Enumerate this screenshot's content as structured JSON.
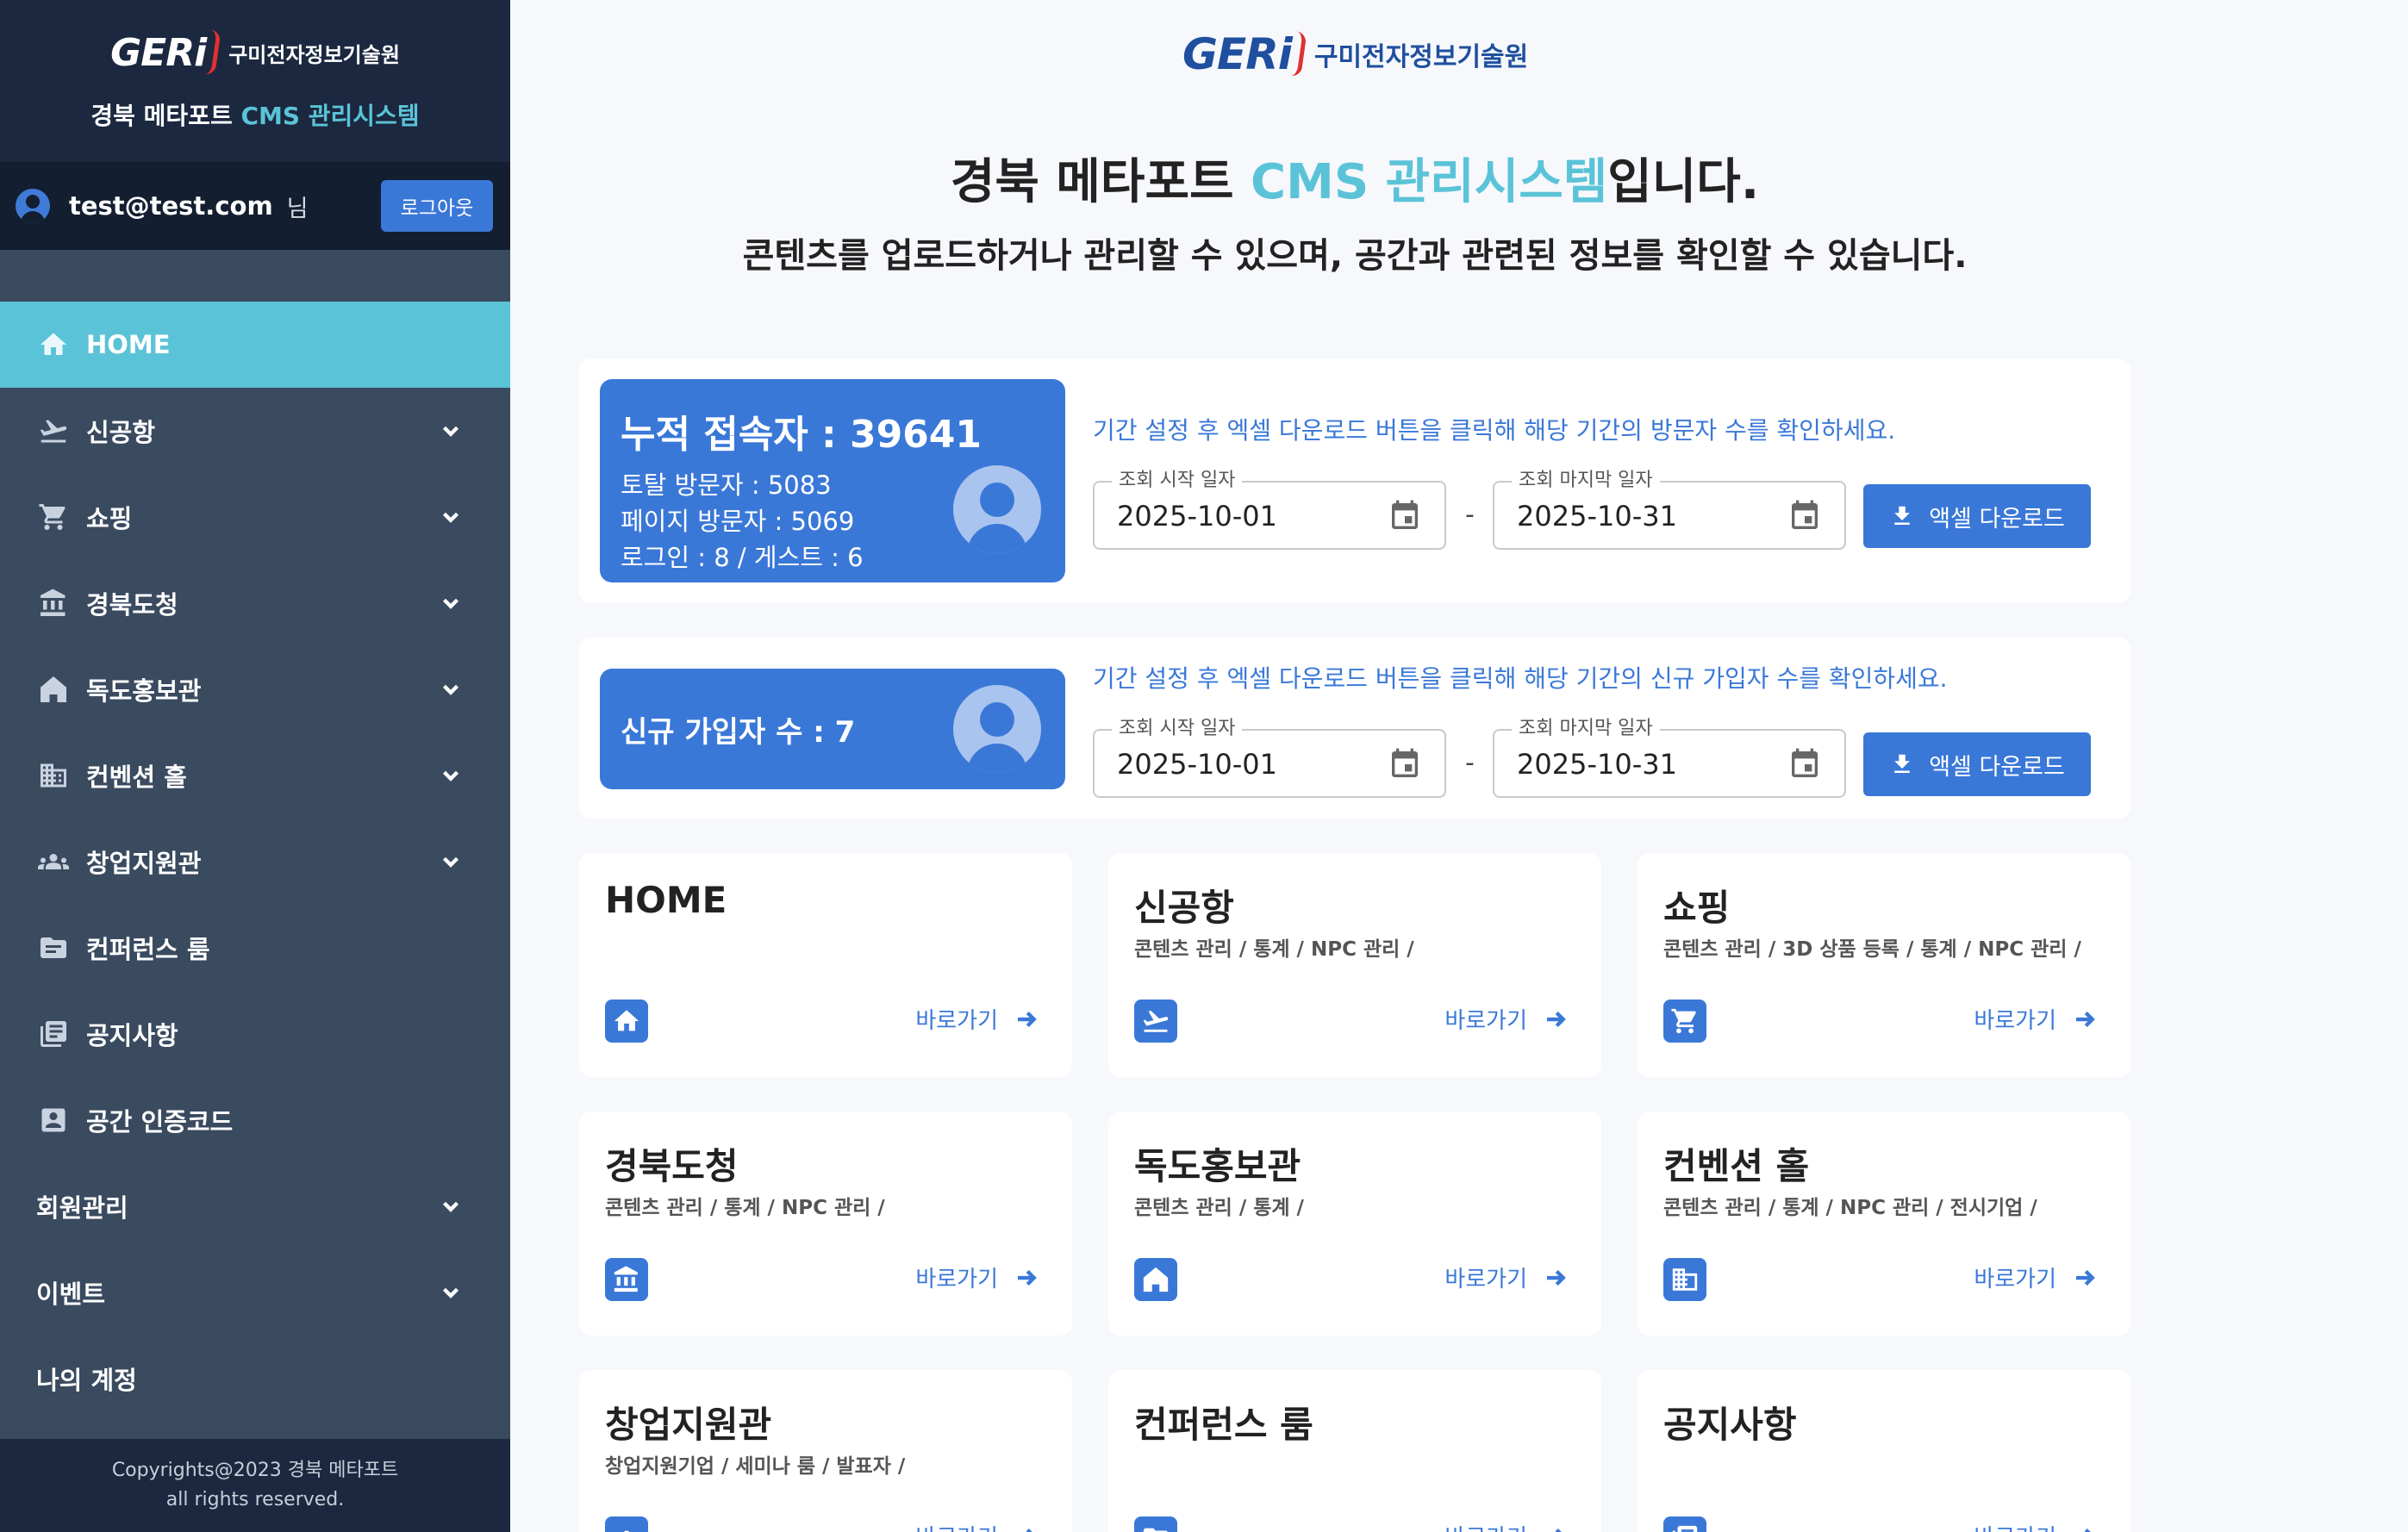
{
  "brand": {
    "logo_text": "GERi",
    "org_name": "구미전자정보기술원",
    "system_title_prefix": "경북 메타포트 ",
    "system_title_accent": "CMS 관리시스템"
  },
  "user": {
    "email": "test@test.com",
    "suffix": "님",
    "logout_label": "로그아웃"
  },
  "sidebar": {
    "items": [
      {
        "label": "HOME",
        "icon": "home-icon",
        "active": true,
        "expandable": false
      },
      {
        "label": "신공항",
        "icon": "airplane-icon",
        "active": false,
        "expandable": true
      },
      {
        "label": "쇼핑",
        "icon": "cart-icon",
        "active": false,
        "expandable": true
      },
      {
        "label": "경북도청",
        "icon": "government-building-icon",
        "active": false,
        "expandable": true
      },
      {
        "label": "독도홍보관",
        "icon": "house-icon",
        "active": false,
        "expandable": true
      },
      {
        "label": "컨벤션 홀",
        "icon": "office-building-icon",
        "active": false,
        "expandable": true
      },
      {
        "label": "창업지원관",
        "icon": "group-icon",
        "active": false,
        "expandable": true
      },
      {
        "label": "컨퍼런스 룸",
        "icon": "folder-icon",
        "active": false,
        "expandable": false
      },
      {
        "label": "공지사항",
        "icon": "notice-board-icon",
        "active": false,
        "expandable": false
      },
      {
        "label": "공간 인증코드",
        "icon": "id-card-icon",
        "active": false,
        "expandable": false
      },
      {
        "label": "회원관리",
        "icon": "",
        "active": false,
        "expandable": true
      },
      {
        "label": "이벤트",
        "icon": "",
        "active": false,
        "expandable": true
      },
      {
        "label": "나의 계정",
        "icon": "",
        "active": false,
        "expandable": false
      }
    ],
    "footer_line1": "Copyrights@2023 경북 메타포트",
    "footer_line2": "all rights reserved."
  },
  "main": {
    "headline_prefix": "경북 메타포트 ",
    "headline_accent": "CMS 관리시스템",
    "headline_suffix": "입니다.",
    "subline": "콘텐츠를 업로드하거나 관리할 수 있으며, 공간과 관련된 정보를 확인할 수 있습니다."
  },
  "visitors": {
    "total_label": "누적 접속자 : 39641",
    "line1": "토탈 방문자 : 5083",
    "line2": "페이지 방문자 : 5069",
    "line3": "로그인 : 8 / 게스트 : 6",
    "hint": "기간 설정 후 엑셀 다운로드 버튼을 클릭해 해당 기간의 방문자 수를 확인하세요.",
    "start_label": "조회 시작 일자",
    "start_value": "2025-10-01",
    "end_label": "조회 마지막 일자",
    "end_value": "2025-10-31",
    "separator": "-",
    "download_label": "액셀 다운로드"
  },
  "signups": {
    "label": "신규 가입자 수 : 7",
    "hint": "기간 설정 후 엑셀 다운로드 버튼을 클릭해 해당 기간의 신규 가입자 수를 확인하세요.",
    "start_label": "조회 시작 일자",
    "start_value": "2025-10-01",
    "end_label": "조회 마지막 일자",
    "end_value": "2025-10-31",
    "separator": "-",
    "download_label": "액셀 다운로드"
  },
  "sections": [
    {
      "title": "HOME",
      "desc": "",
      "icon": "home-icon",
      "link": "바로가기"
    },
    {
      "title": "신공항",
      "desc": "콘텐츠 관리 / 통계 / NPC 관리 /",
      "icon": "airplane-icon",
      "link": "바로가기"
    },
    {
      "title": "쇼핑",
      "desc": "콘텐츠 관리 / 3D 상품 등록 / 통계 / NPC 관리 /",
      "icon": "cart-icon",
      "link": "바로가기"
    },
    {
      "title": "경북도청",
      "desc": "콘텐츠 관리 / 통계 / NPC 관리 /",
      "icon": "government-building-icon",
      "link": "바로가기"
    },
    {
      "title": "독도홍보관",
      "desc": "콘텐츠 관리 / 통계 /",
      "icon": "house-icon",
      "link": "바로가기"
    },
    {
      "title": "컨벤션 홀",
      "desc": "콘텐츠 관리 / 통계 / NPC 관리 / 전시기업 /",
      "icon": "office-building-icon",
      "link": "바로가기"
    },
    {
      "title": "창업지원관",
      "desc": "창업지원기업 / 세미나 룸 / 발표자 /",
      "icon": "group-icon",
      "link": "바로가기"
    },
    {
      "title": "컨퍼런스 룸",
      "desc": "",
      "icon": "folder-icon",
      "link": "바로가기"
    },
    {
      "title": "공지사항",
      "desc": "",
      "icon": "notice-board-icon",
      "link": "바로가기"
    }
  ],
  "colors": {
    "sidebar_bg": "#3a4a5f",
    "sidebar_dark": "#1b2840",
    "accent_cyan": "#5bc3d8",
    "primary_blue": "#3a78d8",
    "page_bg": "#f6f8fc"
  }
}
